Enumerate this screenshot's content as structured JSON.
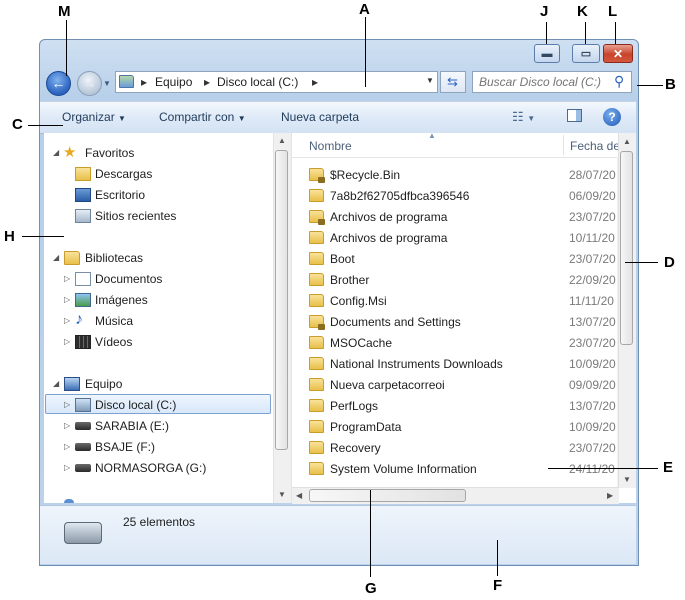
{
  "callouts": {
    "a": "A",
    "b": "B",
    "c": "C",
    "d": "D",
    "e": "E",
    "f": "F",
    "g": "G",
    "h": "H",
    "j": "J",
    "k": "K",
    "l": "L",
    "m": "M"
  },
  "address": {
    "crumbs": [
      "Equipo",
      "Disco local (C:)"
    ]
  },
  "search": {
    "placeholder": "Buscar Disco local (C:)"
  },
  "toolbar": {
    "organize": "Organizar",
    "share": "Compartir con",
    "new_folder": "Nueva carpeta"
  },
  "nav": {
    "favorites": "Favoritos",
    "fav_items": [
      "Descargas",
      "Escritorio",
      "Sitios recientes"
    ],
    "libraries": "Bibliotecas",
    "lib_items": [
      "Documentos",
      "Imágenes",
      "Música",
      "Vídeos"
    ],
    "computer": "Equipo",
    "drives": [
      "Disco local (C:)",
      "SARABIA (E:)",
      "BSAJE (F:)",
      "NORMASORGA (G:)"
    ]
  },
  "columns": {
    "name": "Nombre",
    "date": "Fecha de"
  },
  "files": [
    {
      "name": "$Recycle.Bin",
      "date": "28/07/20",
      "locked": true
    },
    {
      "name": "7a8b2f62705dfbca396546",
      "date": "06/09/20",
      "locked": false
    },
    {
      "name": "Archivos de programa",
      "date": "23/07/20",
      "locked": true
    },
    {
      "name": "Archivos de programa",
      "date": "10/11/20",
      "locked": false
    },
    {
      "name": "Boot",
      "date": "23/07/20",
      "locked": false
    },
    {
      "name": "Brother",
      "date": "22/09/20",
      "locked": false
    },
    {
      "name": "Config.Msi",
      "date": "11/11/20",
      "locked": false
    },
    {
      "name": "Documents and Settings",
      "date": "13/07/20",
      "locked": true
    },
    {
      "name": "MSOCache",
      "date": "23/07/20",
      "locked": false
    },
    {
      "name": "National Instruments Downloads",
      "date": "10/09/20",
      "locked": false
    },
    {
      "name": "Nueva carpetacorreoi",
      "date": "09/09/20",
      "locked": false
    },
    {
      "name": "PerfLogs",
      "date": "13/07/20",
      "locked": false
    },
    {
      "name": "ProgramData",
      "date": "10/09/20",
      "locked": false
    },
    {
      "name": "Recovery",
      "date": "23/07/20",
      "locked": false
    },
    {
      "name": "System Volume Information",
      "date": "24/11/20",
      "locked": false
    }
  ],
  "details": {
    "count": "25 elementos"
  },
  "colors": {
    "accent": "#2a62bf",
    "close": "#c8432a",
    "selection": "#d9e8fb"
  }
}
